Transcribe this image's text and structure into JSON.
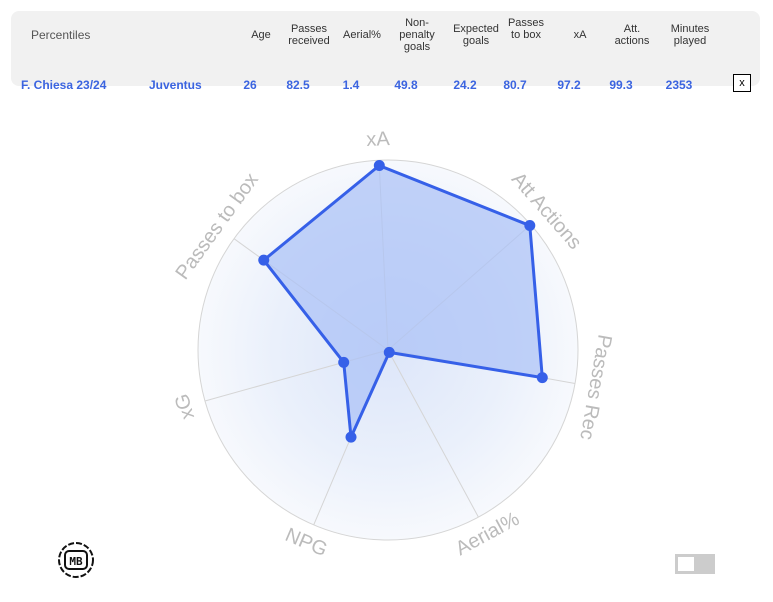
{
  "table": {
    "title": "Percentiles",
    "headers": [
      "Age",
      "Passes received",
      "Aerial%",
      "Non-penalty goals",
      "Expected goals",
      "Passes to box",
      "xA",
      "Att. actions",
      "Minutes played"
    ],
    "row": {
      "player": "F. Chiesa 23/24",
      "team": "Juventus",
      "values": [
        "26",
        "82.5",
        "1.4",
        "49.8",
        "24.2",
        "80.7",
        "97.2",
        "99.3",
        "2353"
      ]
    },
    "close_label": "x"
  },
  "chart_data": {
    "type": "radar",
    "axes": [
      "xA",
      "Att Actions",
      "Passes Rec",
      "Aerial%",
      "NPG",
      "xG",
      "Passes to box"
    ],
    "series": [
      {
        "values": [
          97.2,
          99.3,
          82.5,
          1.4,
          49.8,
          24.2,
          80.7
        ]
      }
    ],
    "range": [
      0,
      100
    ],
    "colors": {
      "line": "#3660e8",
      "fill": "#a9c0f7",
      "grid": "#d5d5d5"
    }
  },
  "logo": {
    "text": "MB"
  }
}
